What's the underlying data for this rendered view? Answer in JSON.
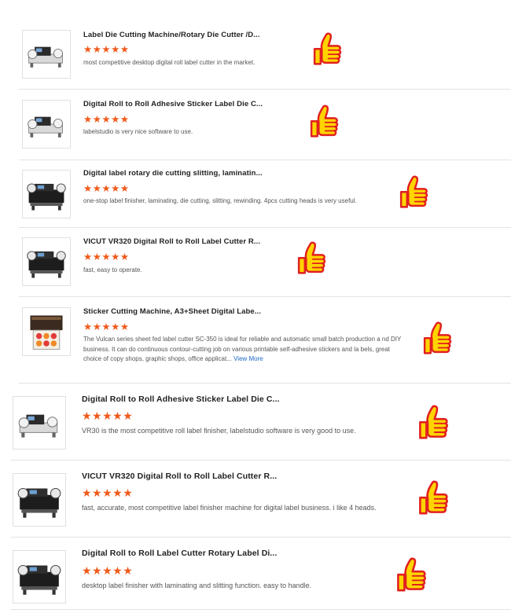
{
  "reviews": [
    {
      "title": "Label Die Cutting Machine/Rotary Die Cutter /D...",
      "stars": "★★★★★",
      "text": "most competitive desktop digital roll label cutter in the market.",
      "image": "label-cutter-white"
    },
    {
      "title": "Digital Roll to Roll Adhesive Sticker Label Die C...",
      "stars": "★★★★★",
      "text": "labelstudio is very nice software to use.",
      "image": "label-cutter-white"
    },
    {
      "title": "Digital label rotary die cutting slitting, laminatin...",
      "stars": "★★★★★",
      "text": "one-stop label finisher, laminating, die cutting, slitting, rewinding. 4pcs cutting heads is very useful.",
      "image": "label-cutter-black"
    },
    {
      "title": "VICUT VR320 Digital Roll to Roll Label Cutter R...",
      "stars": "★★★★★",
      "text": "fast, easy to operate.",
      "image": "label-cutter-black"
    },
    {
      "title": "Sticker Cutting Machine, A3+Sheet Digital Labe...",
      "stars": "★★★★★",
      "text": "The Vulcan series sheet fed label cutter SC-350 is ideal for reliable and automatic small batch production a nd DIY business. It can do continuous contour-cutting job on various printable self-adhesive stickers and la bels, great choice of copy shops, graphic shops, office applicat...",
      "more": "View More",
      "image": "sheet-cutter"
    },
    {
      "title": "Digital Roll to Roll Adhesive Sticker Label Die C...",
      "stars": "★★★★★",
      "text": "VR30 is the most competitive roll label finisher, labelstudio software is very good to use.",
      "image": "label-cutter-white"
    },
    {
      "title": "VICUT VR320 Digital Roll to Roll Label Cutter R...",
      "stars": "★★★★★",
      "text": "fast, accurate, most competitive label finisher machine for digital label business. i like 4 heads.",
      "image": "label-cutter-black"
    },
    {
      "title": "Digital Roll to Roll Label Cutter Rotary Label Di...",
      "stars": "★★★★★",
      "text": "desktop label finisher with laminating and slitting function. easy to handle.",
      "image": "label-cutter-black"
    }
  ],
  "icons": {
    "rating": "star-icon",
    "reaction": "thumbs-up-icon"
  },
  "colors": {
    "star": "#f05a1a",
    "thumb_fill": "#ffd400",
    "thumb_outline": "#e02020",
    "link": "#1a66c8"
  }
}
